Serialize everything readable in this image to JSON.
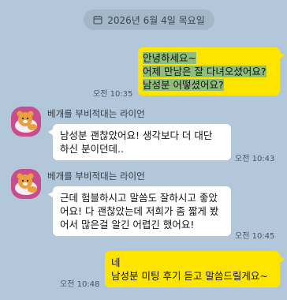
{
  "date_label": "2026년 6월 4일 목요일",
  "icons": {
    "date": "calendar-icon",
    "avatar": "lion-character-avatar"
  },
  "colors": {
    "background": "#b2c7d9",
    "my_bubble": "#fee500",
    "highlight": "#8fbe7a"
  },
  "messages": [
    {
      "from": "me",
      "lines": [
        "안녕하세요~",
        "어제 만남은 잘 다녀오셨어요?",
        "남성분 어떻셨어요?"
      ],
      "time": "오전 10:35"
    },
    {
      "from": "other",
      "sender": "베개를 부비적대는 라이언",
      "lines": [
        "남성분 괜찮았어요! 생각보다 더 대단",
        "하신 분이던데.."
      ],
      "time": "오전 10:43"
    },
    {
      "from": "other",
      "sender": "베개를 부비적대는 라이언",
      "lines": [
        "근데 험블하시고 말씀도 잘하시고 좋았",
        "어요! 다 괜찮았는데 저희가 좀 짧게 봤",
        "어서 많은걸 알긴 어렵긴 했어요!"
      ],
      "time": "오전 10:45"
    },
    {
      "from": "me",
      "lines": [
        "네",
        "남성분 미팅 후기 듣고 말씀드릴게요~"
      ],
      "time": "오전 10:48"
    }
  ]
}
